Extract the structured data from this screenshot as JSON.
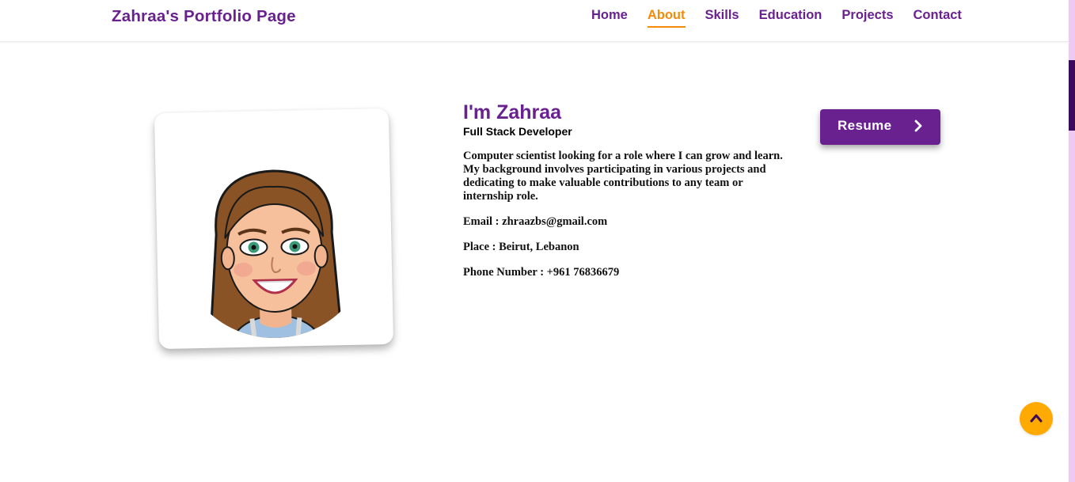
{
  "header": {
    "brand": "Zahraa's Portfolio Page",
    "nav": [
      {
        "label": "Home",
        "active": false
      },
      {
        "label": "About",
        "active": true
      },
      {
        "label": "Skills",
        "active": false
      },
      {
        "label": "Education",
        "active": false
      },
      {
        "label": "Projects",
        "active": false
      },
      {
        "label": "Contact",
        "active": false
      }
    ]
  },
  "about": {
    "title": "I'm Zahraa",
    "subtitle": "Full Stack Developer",
    "description": "Computer scientist looking for a role where I can grow and learn. My background involves participating in various projects and dedicating to make valuable contributions to any team or internship role.",
    "email": "Email : zhraazbs@gmail.com",
    "place": "Place : Beirut, Lebanon",
    "phone": "Phone Number : +961 76836679"
  },
  "resume": {
    "label": "Resume",
    "icon": "chevron-right-icon"
  },
  "scroll_top": {
    "icon": "chevron-up-icon"
  },
  "colors": {
    "brand": "#6a2190",
    "accent": "#f58a0b",
    "scroll_top": "#ffaa00"
  }
}
